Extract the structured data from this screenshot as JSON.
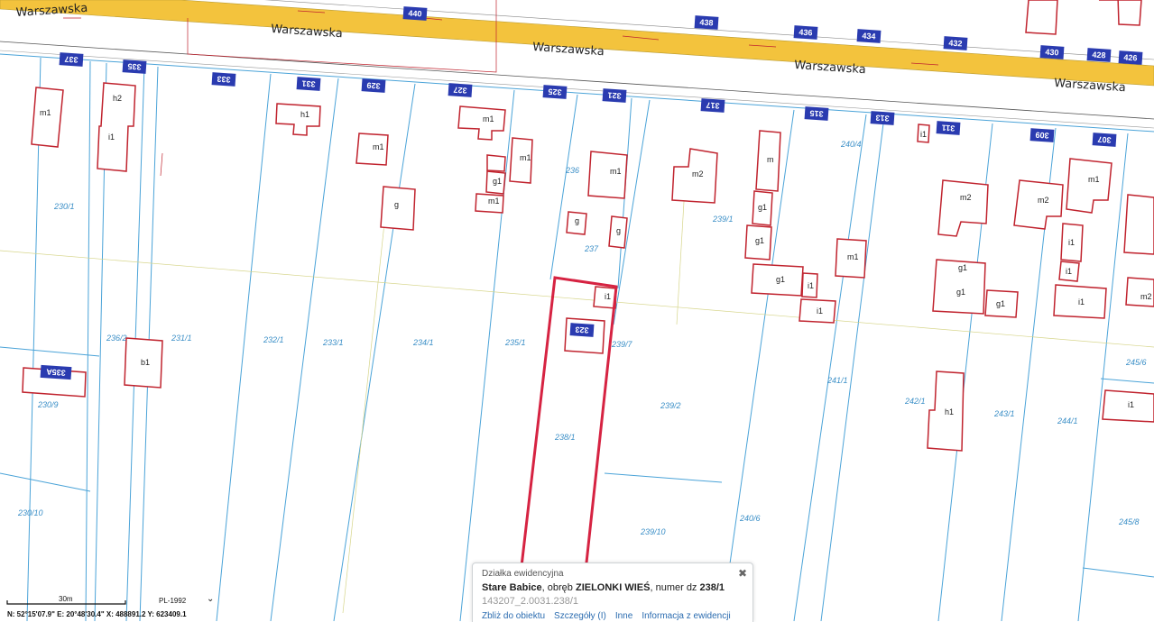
{
  "map": {
    "street_name": "Warszawska",
    "house_numbers": [
      "440",
      "438",
      "436",
      "434",
      "432",
      "430",
      "428",
      "426",
      "337",
      "335",
      "333",
      "331",
      "329",
      "327",
      "325",
      "321",
      "317",
      "315",
      "313",
      "311",
      "309",
      "307",
      "323",
      "335A"
    ],
    "parcel_labels": [
      "230/1",
      "230/9",
      "230/10",
      "231/1",
      "232/1",
      "233/1",
      "234/1",
      "235/1",
      "236",
      "237",
      "238/1",
      "239/1",
      "239/2",
      "239/7",
      "239/10",
      "240/4",
      "240/6",
      "241/1",
      "242/1",
      "243/1",
      "244/1",
      "245/6",
      "245/8",
      "236/2"
    ],
    "building_labels": [
      "m1",
      "h2",
      "i1",
      "h1",
      "m1",
      "m1",
      "g",
      "g1",
      "m1",
      "m1",
      "m2",
      "m1",
      "g",
      "g",
      "i1",
      "b1",
      "m",
      "g1",
      "g1",
      "g1",
      "i1",
      "i1",
      "m1",
      "m2",
      "g1",
      "g1",
      "g1",
      "m2",
      "i1",
      "i1",
      "m1",
      "i1",
      "m2",
      "h1",
      "i1",
      "i1"
    ],
    "colors": {
      "road": "#f3c33d",
      "parcel": "#4aa3d8",
      "building": "#c0232e",
      "selected": "#d62342",
      "house_number_bg": "#2a3bb0"
    }
  },
  "footer": {
    "scale_text": "30m",
    "crs": "PL-1992",
    "coords": "N: 52°15'07.9\"  E: 20°48'30.4\"  X: 488891.2  Y: 623409.1"
  },
  "popup": {
    "title": "Działka ewidencyjna",
    "commune": "Stare Babice",
    "text_obreb": ", obręb ",
    "precinct": "ZIELONKI WIEŚ",
    "text_numer": ", numer dz ",
    "parcel_number": "238/1",
    "identifier": "143207_2.0031.238/1",
    "links": [
      "Zbliż do obiektu",
      "Szczegóły (I)",
      "Inne",
      "Informacja z ewidencji"
    ],
    "close_icon": "close-icon"
  }
}
